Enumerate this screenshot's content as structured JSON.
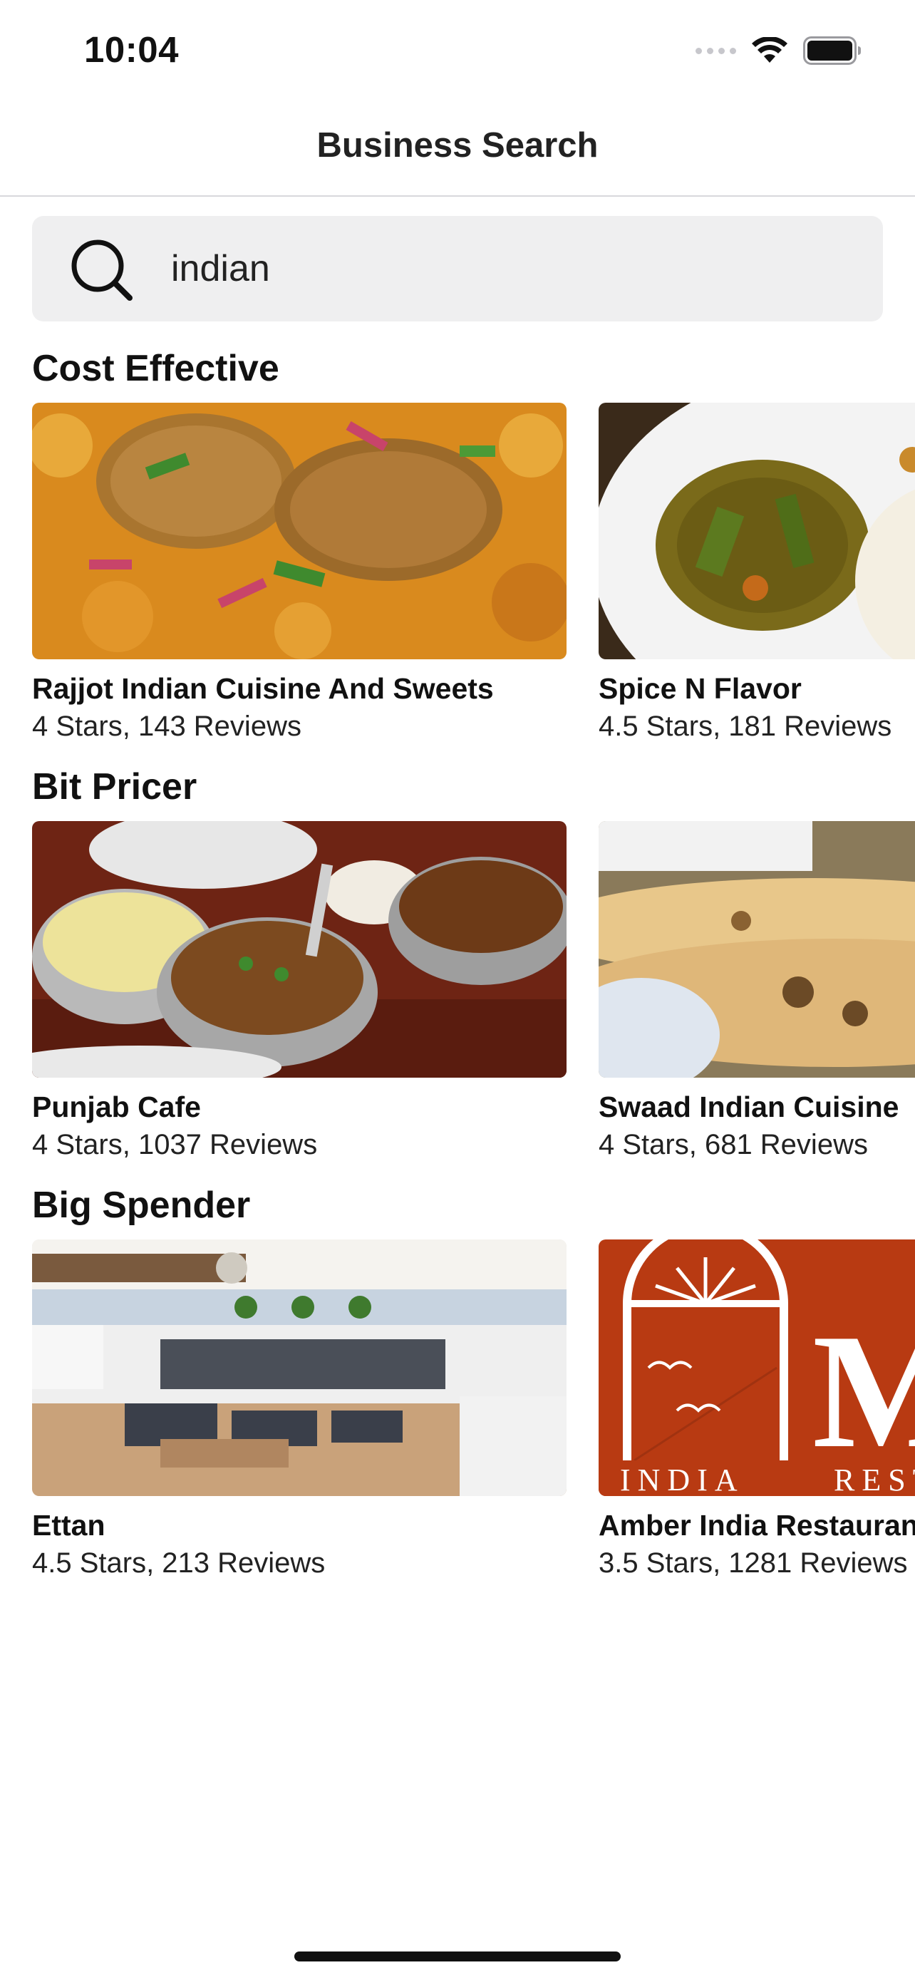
{
  "status_bar": {
    "time": "10:04",
    "icons": [
      "cellular-signal-icon",
      "wifi-icon",
      "battery-icon"
    ]
  },
  "nav": {
    "title": "Business Search"
  },
  "search": {
    "value": "indian",
    "icon": "search-icon"
  },
  "sections": [
    {
      "title": "Cost Effective",
      "cards": [
        {
          "name": "Rajjot Indian Cuisine And Sweets",
          "meta": "4 Stars, 143 Reviews",
          "image": "food-photo-aloo-tikki-chole"
        },
        {
          "name": "Spice N Flavor",
          "meta": "4.5 Stars, 181 Reviews",
          "image": "food-photo-curry-with-rice"
        }
      ]
    },
    {
      "title": "Bit Pricer",
      "cards": [
        {
          "name": "Punjab Cafe",
          "meta": "4 Stars, 1037 Reviews",
          "image": "food-photo-dal-rice-bowls"
        },
        {
          "name": "Swaad Indian Cuisine",
          "meta": "4 Stars, 681 Reviews",
          "image": "food-photo-naan"
        }
      ]
    },
    {
      "title": "Big Spender",
      "cards": [
        {
          "name": "Ettan",
          "meta": "4.5 Stars, 213 Reviews",
          "image": "restaurant-interior-photo"
        },
        {
          "name": "Amber India Restaurant",
          "meta": "3.5 Stars, 1281 Reviews",
          "image": "amber-india-logo",
          "logo_text": [
            "INDIA",
            "REST"
          ]
        }
      ]
    }
  ],
  "colors": {
    "search_bg": "#efeff0",
    "divider": "#d8d8dc",
    "text": "#111111",
    "amber_brand": "#b83a12"
  }
}
